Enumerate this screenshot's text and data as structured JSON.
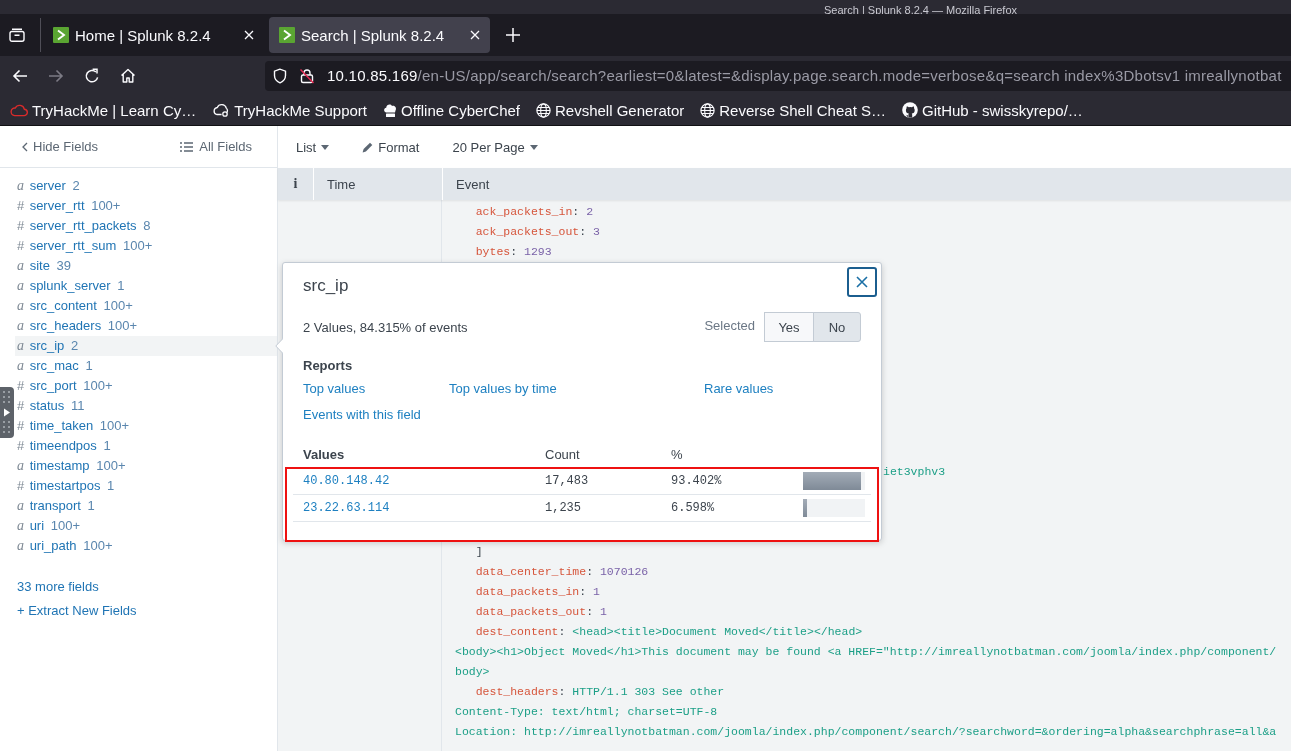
{
  "window": {
    "title": "Search | Splunk 8.2.4 — Mozilla Firefox"
  },
  "tabs": [
    {
      "label": "Home | Splunk 8.2.4",
      "selected": false
    },
    {
      "label": "Search | Splunk 8.2.4",
      "selected": true
    }
  ],
  "navigation": {
    "back_disabled": false,
    "forward_disabled": true
  },
  "address_bar": {
    "host": "10.10.85.169",
    "path": "/en-US/app/search/search?earliest=0&latest=&display.page.search.mode=verbose&q=search index%3Dbotsv1 imreallynotbat"
  },
  "bookmarks": [
    {
      "label": "TryHackMe | Learn Cy…",
      "kind": "cloud"
    },
    {
      "label": "TryHackMe Support",
      "kind": "cloudsync"
    },
    {
      "label": "Offline CyberChef",
      "kind": "chef"
    },
    {
      "label": "Revshell Generator",
      "kind": "globe"
    },
    {
      "label": "Reverse Shell Cheat S…",
      "kind": "globe"
    },
    {
      "label": "GitHub - swisskyrepo/…",
      "kind": "octocat"
    }
  ],
  "sidebar": {
    "hide_fields": "Hide Fields",
    "all_fields": "All Fields",
    "fields": [
      {
        "kind": "string",
        "type": "a",
        "name": "server",
        "count": "2",
        "selected": false
      },
      {
        "kind": "number",
        "type": "#",
        "name": "server_rtt",
        "count": "100+",
        "selected": false
      },
      {
        "kind": "number",
        "type": "#",
        "name": "server_rtt_packets",
        "count": "8",
        "selected": false
      },
      {
        "kind": "number",
        "type": "#",
        "name": "server_rtt_sum",
        "count": "100+",
        "selected": false
      },
      {
        "kind": "string",
        "type": "a",
        "name": "site",
        "count": "39",
        "selected": false
      },
      {
        "kind": "string",
        "type": "a",
        "name": "splunk_server",
        "count": "1",
        "selected": false
      },
      {
        "kind": "string",
        "type": "a",
        "name": "src_content",
        "count": "100+",
        "selected": false
      },
      {
        "kind": "string",
        "type": "a",
        "name": "src_headers",
        "count": "100+",
        "selected": false
      },
      {
        "kind": "string",
        "type": "a",
        "name": "src_ip",
        "count": "2",
        "selected": true
      },
      {
        "kind": "string",
        "type": "a",
        "name": "src_mac",
        "count": "1",
        "selected": false
      },
      {
        "kind": "number",
        "type": "#",
        "name": "src_port",
        "count": "100+",
        "selected": false
      },
      {
        "kind": "number",
        "type": "#",
        "name": "status",
        "count": "11",
        "selected": false
      },
      {
        "kind": "number",
        "type": "#",
        "name": "time_taken",
        "count": "100+",
        "selected": false
      },
      {
        "kind": "number",
        "type": "#",
        "name": "timeendpos",
        "count": "1",
        "selected": false
      },
      {
        "kind": "string",
        "type": "a",
        "name": "timestamp",
        "count": "100+",
        "selected": false
      },
      {
        "kind": "number",
        "type": "#",
        "name": "timestartpos",
        "count": "1",
        "selected": false
      },
      {
        "kind": "string",
        "type": "a",
        "name": "transport",
        "count": "1",
        "selected": false
      },
      {
        "kind": "string",
        "type": "a",
        "name": "uri",
        "count": "100+",
        "selected": false
      },
      {
        "kind": "string",
        "type": "a",
        "name": "uri_path",
        "count": "100+",
        "selected": false
      }
    ],
    "more_fields": "33 more fields",
    "extract_fields": "+ Extract New Fields"
  },
  "results_toolbar": [
    {
      "label": "List",
      "kind": "menu"
    },
    {
      "label": "Format",
      "kind": "edit"
    },
    {
      "label": "20 Per Page",
      "kind": "menu"
    }
  ],
  "table": {
    "columns": [
      "i",
      "Time",
      "Event"
    ],
    "event_top": [
      {
        "kind": "number",
        "text": "ack_packets_in: 2"
      },
      {
        "kind": "number",
        "text": "ack_packets_out: 3"
      },
      {
        "kind": "number",
        "text": "bytes: 1293"
      }
    ],
    "event_fragment": "iet3vphv3",
    "event_bottom": [
      {
        "kind": "plain",
        "text": "]"
      },
      {
        "kind": "number",
        "text": "data_center_time: 1070126"
      },
      {
        "kind": "number",
        "text": "data_packets_in: 1"
      },
      {
        "kind": "number",
        "text": "data_packets_out: 1"
      },
      {
        "kind": "string",
        "text": "dest_content: <head><title>Document Moved</title></head>"
      },
      {
        "kind": "continuation",
        "text": "<body><h1>Object Moved</h1>This document may be found <a HREF=\"http://imreallynotbatman.com/joomla/index.php/component/"
      },
      {
        "kind": "continuation",
        "text": "body>"
      },
      {
        "kind": "string",
        "text": "dest_headers: HTTP/1.1 303 See other"
      },
      {
        "kind": "continuation",
        "text": "Content-Type: text/html; charset=UTF-8"
      },
      {
        "kind": "continuation",
        "text": "Location: http://imreallynotbatman.com/joomla/index.php/component/search/?searchword=&ordering=alpha&searchphrase=all&a"
      }
    ]
  },
  "field_popup": {
    "title": "src_ip",
    "summary": "2 Values, 84.315% of events",
    "selected_label": "Selected",
    "toggle": [
      {
        "label": "Yes",
        "selected": false
      },
      {
        "label": "No",
        "selected": true
      }
    ],
    "reports_heading": "Reports",
    "reports": [
      "Top values",
      "Top values by time",
      "Rare values",
      "Events with this field"
    ],
    "values_table": {
      "highlighted": true,
      "columns": [
        "Values",
        "Count",
        "%"
      ],
      "rows": [
        {
          "value": "40.80.148.42",
          "count": "17,483",
          "percent": "93.402%",
          "level": 0.934
        },
        {
          "value": "23.22.63.114",
          "count": "1,235",
          "percent": "6.598%",
          "level": 0.066
        }
      ]
    }
  }
}
